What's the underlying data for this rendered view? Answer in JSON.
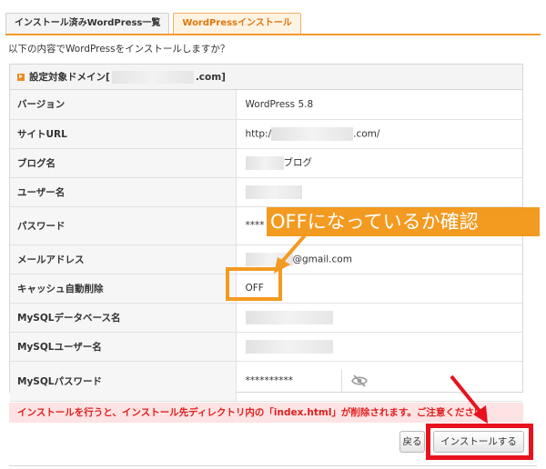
{
  "tabs": [
    {
      "label": "インストール済みWordPress一覧"
    },
    {
      "label": "WordPressインストール"
    }
  ],
  "question": "以下の内容でWordPressをインストールしますか？",
  "panel": {
    "head_prefix": "設定対象ドメイン[",
    "head_suffix": ".com]"
  },
  "rows": {
    "version": {
      "label": "バージョン",
      "value": "WordPress 5.8"
    },
    "site_url": {
      "label": "サイトURL",
      "prefix": "http:/",
      "suffix": ".com/"
    },
    "blog_name": {
      "label": "ブログ名",
      "suffix": "ブログ"
    },
    "user_name": {
      "label": "ユーザー名"
    },
    "password": {
      "label": "パスワード",
      "value": "****"
    },
    "email": {
      "label": "メールアドレス",
      "suffix": "@gmail.com"
    },
    "cache": {
      "label": "キャッシュ自動削除",
      "value": "OFF"
    },
    "db_name": {
      "label": "MySQLデータベース名"
    },
    "db_user": {
      "label": "MySQLユーザー名"
    },
    "db_password": {
      "label": "MySQLパスワード",
      "value": "**********"
    }
  },
  "warning": "インストールを行うと、インストール先ディレクトリ内の「index.html」が削除されます。ご注意ください。",
  "buttons": {
    "back": "戻る",
    "install": "インストールする"
  },
  "annotation": {
    "callout": "OFFになっているか確認",
    "accent_orange": "#f39a20",
    "accent_red": "#e8121e"
  },
  "icons": {
    "password_toggle": "eye-slash-icon"
  }
}
